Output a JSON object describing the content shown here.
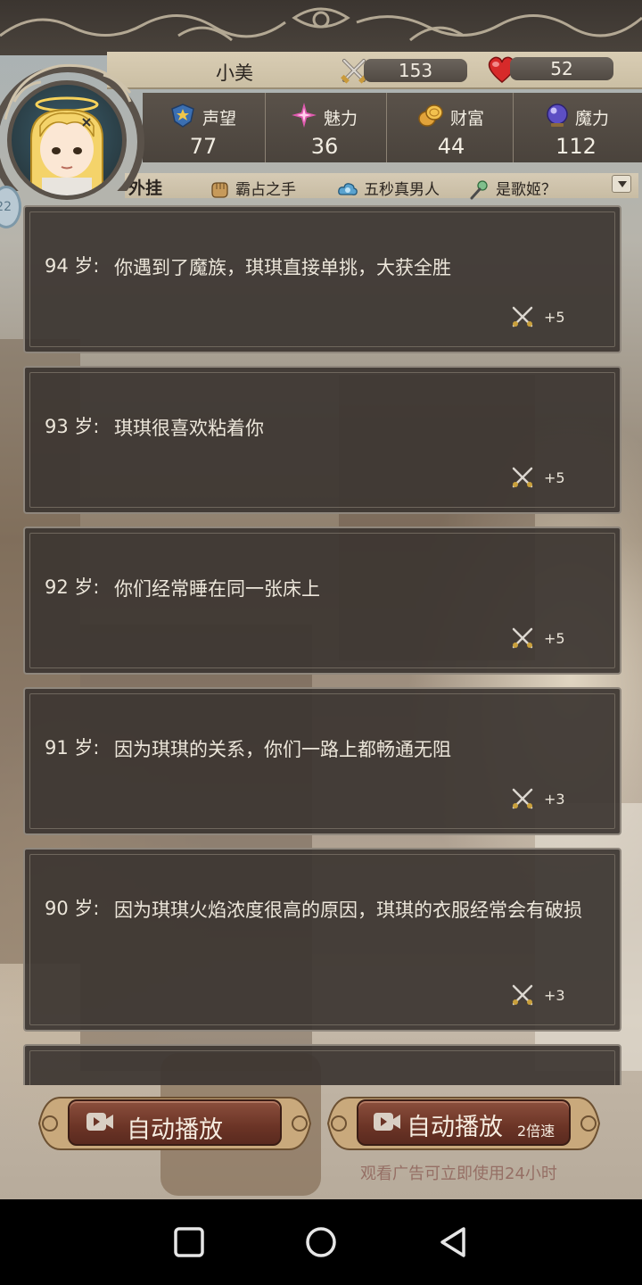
{
  "player": {
    "name": "小美",
    "attack": "153",
    "health": "52"
  },
  "stats": [
    {
      "label": "声望",
      "value": "77",
      "icon": "medal-icon"
    },
    {
      "label": "魅力",
      "value": "36",
      "icon": "sparkle-icon"
    },
    {
      "label": "财富",
      "value": "44",
      "icon": "coins-icon"
    },
    {
      "label": "魔力",
      "value": "112",
      "icon": "magic-orb-icon"
    }
  ],
  "traits": {
    "title": "外挂",
    "items": [
      {
        "label": "霸占之手",
        "icon": "fist-icon"
      },
      {
        "label": "五秒真男人",
        "icon": "cloud-icon"
      },
      {
        "label": "是歌姬？",
        "icon": "microphone-icon"
      }
    ]
  },
  "side_badge": "22",
  "events": [
    {
      "age": "94 岁:",
      "text": "你遇到了魔族，琪琪直接单挑，大获全胜",
      "reward": "+5"
    },
    {
      "age": "93 岁:",
      "text": "琪琪很喜欢粘着你",
      "reward": "+5"
    },
    {
      "age": "92 岁:",
      "text": "你们经常睡在同一张床上",
      "reward": "+5"
    },
    {
      "age": "91 岁:",
      "text": "因为琪琪的关系，你们一路上都畅通无阻",
      "reward": "+3"
    },
    {
      "age": "90 岁:",
      "text": "因为琪琪火焰浓度很高的原因，琪琪的衣服经常会有破损",
      "reward": "+3"
    }
  ],
  "buttons": {
    "autoplay_label": "自动播放",
    "autoplay2x_label": "自动播放",
    "autoplay2x_speed": "2倍速",
    "ad_note": "观看广告可立即使用24小时"
  }
}
